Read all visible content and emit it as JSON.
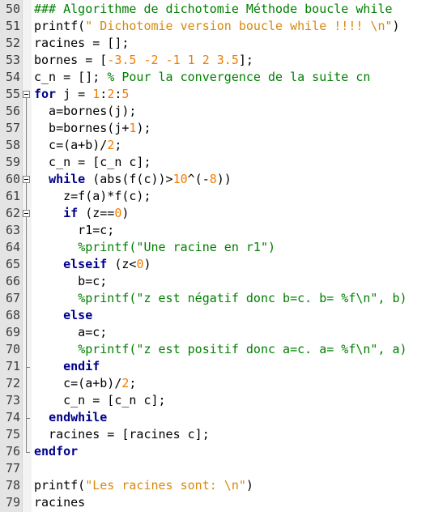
{
  "editor": {
    "lines": [
      {
        "n": "50",
        "tokens": [
          {
            "t": "### Algorithme de dichotomie Méthode boucle while",
            "c": "comment"
          }
        ]
      },
      {
        "n": "51",
        "tokens": [
          {
            "t": "printf(",
            "c": "plain"
          },
          {
            "t": "\" Dichotomie version boucle while !!!! \\n\"",
            "c": "string"
          },
          {
            "t": ")",
            "c": "plain"
          }
        ]
      },
      {
        "n": "52",
        "tokens": [
          {
            "t": "racines = [];",
            "c": "plain"
          }
        ]
      },
      {
        "n": "53",
        "tokens": [
          {
            "t": "bornes = [",
            "c": "plain"
          },
          {
            "t": "-3.5 -2 -1 1 2 3.5",
            "c": "number"
          },
          {
            "t": "];",
            "c": "plain"
          }
        ]
      },
      {
        "n": "54",
        "tokens": [
          {
            "t": "c_n = []; ",
            "c": "plain"
          },
          {
            "t": "% Pour la convergence de la suite cn",
            "c": "comment"
          }
        ]
      },
      {
        "n": "55",
        "tokens": [
          {
            "t": "for",
            "c": "kw"
          },
          {
            "t": " j = ",
            "c": "plain"
          },
          {
            "t": "1",
            "c": "number"
          },
          {
            "t": ":",
            "c": "plain"
          },
          {
            "t": "2",
            "c": "number"
          },
          {
            "t": ":",
            "c": "plain"
          },
          {
            "t": "5",
            "c": "number"
          }
        ]
      },
      {
        "n": "56",
        "tokens": [
          {
            "t": "  a=bornes(j);",
            "c": "plain"
          }
        ]
      },
      {
        "n": "57",
        "tokens": [
          {
            "t": "  b=bornes(j+",
            "c": "plain"
          },
          {
            "t": "1",
            "c": "number"
          },
          {
            "t": ");",
            "c": "plain"
          }
        ]
      },
      {
        "n": "58",
        "tokens": [
          {
            "t": "  c=(a+b)/",
            "c": "plain"
          },
          {
            "t": "2",
            "c": "number"
          },
          {
            "t": ";",
            "c": "plain"
          }
        ]
      },
      {
        "n": "59",
        "tokens": [
          {
            "t": "  c_n = [c_n c];",
            "c": "plain"
          }
        ]
      },
      {
        "n": "60",
        "tokens": [
          {
            "t": "  ",
            "c": "plain"
          },
          {
            "t": "while",
            "c": "kw"
          },
          {
            "t": " (abs(f(c))>",
            "c": "plain"
          },
          {
            "t": "10",
            "c": "number"
          },
          {
            "t": "^(-",
            "c": "plain"
          },
          {
            "t": "8",
            "c": "number"
          },
          {
            "t": "))",
            "c": "plain"
          }
        ]
      },
      {
        "n": "61",
        "tokens": [
          {
            "t": "    z=f(a)*f(c);",
            "c": "plain"
          }
        ]
      },
      {
        "n": "62",
        "tokens": [
          {
            "t": "    ",
            "c": "plain"
          },
          {
            "t": "if",
            "c": "kw"
          },
          {
            "t": " (z==",
            "c": "plain"
          },
          {
            "t": "0",
            "c": "number"
          },
          {
            "t": ")",
            "c": "plain"
          }
        ]
      },
      {
        "n": "63",
        "tokens": [
          {
            "t": "      r1=c;",
            "c": "plain"
          }
        ]
      },
      {
        "n": "64",
        "tokens": [
          {
            "t": "      ",
            "c": "plain"
          },
          {
            "t": "%printf(\"Une racine en r1\")",
            "c": "comment"
          }
        ]
      },
      {
        "n": "65",
        "tokens": [
          {
            "t": "    ",
            "c": "plain"
          },
          {
            "t": "elseif",
            "c": "kw"
          },
          {
            "t": " (z<",
            "c": "plain"
          },
          {
            "t": "0",
            "c": "number"
          },
          {
            "t": ")",
            "c": "plain"
          }
        ]
      },
      {
        "n": "66",
        "tokens": [
          {
            "t": "      b=c;",
            "c": "plain"
          }
        ]
      },
      {
        "n": "67",
        "tokens": [
          {
            "t": "      ",
            "c": "plain"
          },
          {
            "t": "%printf(\"z est négatif donc b=c. b= %f\\n\", b)",
            "c": "comment"
          }
        ]
      },
      {
        "n": "68",
        "tokens": [
          {
            "t": "    ",
            "c": "plain"
          },
          {
            "t": "else",
            "c": "kw"
          }
        ]
      },
      {
        "n": "69",
        "tokens": [
          {
            "t": "      a=c;",
            "c": "plain"
          }
        ]
      },
      {
        "n": "70",
        "tokens": [
          {
            "t": "      ",
            "c": "plain"
          },
          {
            "t": "%printf(\"z est positif donc a=c. a= %f\\n\", a)",
            "c": "comment"
          }
        ]
      },
      {
        "n": "71",
        "tokens": [
          {
            "t": "    ",
            "c": "plain"
          },
          {
            "t": "endif",
            "c": "kw"
          }
        ]
      },
      {
        "n": "72",
        "tokens": [
          {
            "t": "    c=(a+b)/",
            "c": "plain"
          },
          {
            "t": "2",
            "c": "number"
          },
          {
            "t": ";",
            "c": "plain"
          }
        ]
      },
      {
        "n": "73",
        "tokens": [
          {
            "t": "    c_n = [c_n c];",
            "c": "plain"
          }
        ]
      },
      {
        "n": "74",
        "tokens": [
          {
            "t": "  ",
            "c": "plain"
          },
          {
            "t": "endwhile",
            "c": "kw"
          }
        ]
      },
      {
        "n": "75",
        "tokens": [
          {
            "t": "  racines = [racines c];",
            "c": "plain"
          }
        ]
      },
      {
        "n": "76",
        "tokens": [
          {
            "t": "endfor",
            "c": "kw"
          }
        ]
      },
      {
        "n": "77",
        "tokens": []
      },
      {
        "n": "78",
        "tokens": [
          {
            "t": "printf(",
            "c": "plain"
          },
          {
            "t": "\"Les racines sont: \\n\"",
            "c": "string"
          },
          {
            "t": ")",
            "c": "plain"
          }
        ]
      },
      {
        "n": "79",
        "tokens": [
          {
            "t": "racines",
            "c": "plain"
          }
        ]
      }
    ],
    "folds": [
      {
        "start_line": "55",
        "end_line": "76"
      },
      {
        "start_line": "60",
        "end_line": "74"
      },
      {
        "start_line": "62",
        "end_line": "71"
      }
    ],
    "colors": {
      "keyword": "#00008b",
      "comment": "#008000",
      "string": "#d8880a",
      "number": "#f47c00",
      "gutter": "#e4e4e4"
    }
  }
}
